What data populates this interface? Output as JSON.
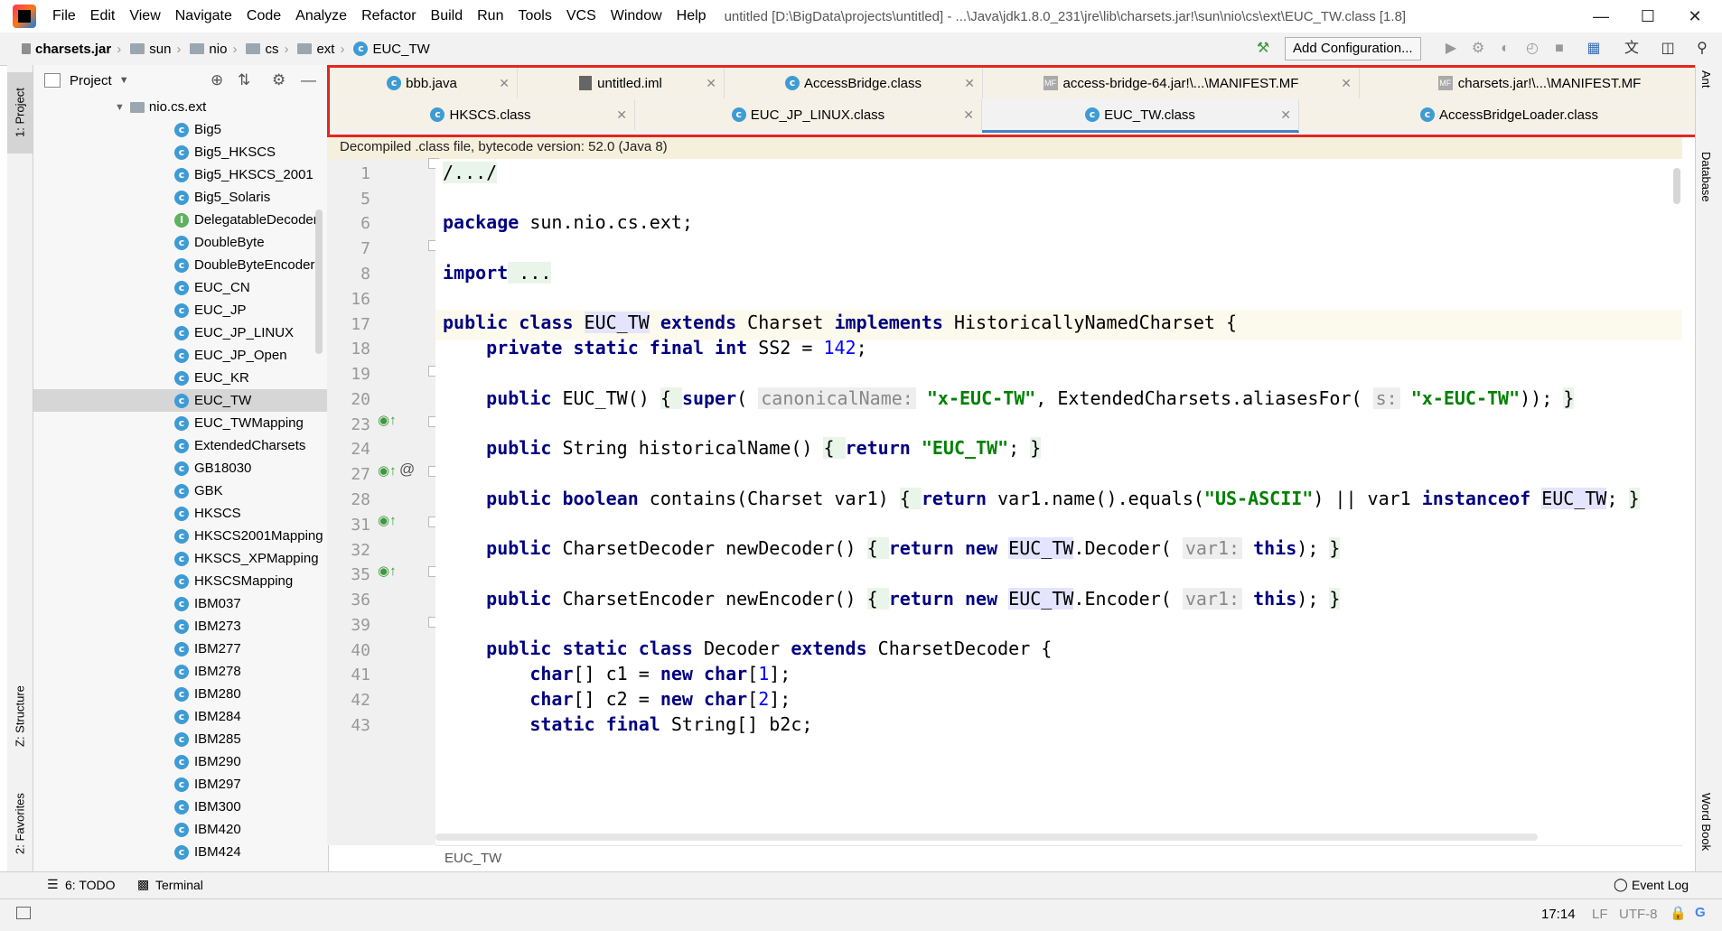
{
  "menubar": {
    "items": [
      "File",
      "Edit",
      "View",
      "Navigate",
      "Code",
      "Analyze",
      "Refactor",
      "Build",
      "Run",
      "Tools",
      "VCS",
      "Window",
      "Help"
    ],
    "window_title": "untitled [D:\\BigData\\projects\\untitled] - ...\\Java\\jdk1.8.0_231\\jre\\lib\\charsets.jar!\\sun\\nio\\cs\\ext\\EUC_TW.class [1.8]"
  },
  "navbar": {
    "crumbs": [
      "charsets.jar",
      "sun",
      "nio",
      "cs",
      "ext",
      "EUC_TW"
    ],
    "add_config": "Add Configuration..."
  },
  "left_strip": {
    "project": "1: Project",
    "structure": "Z: Structure",
    "favorites": "2: Favorites"
  },
  "project_panel": {
    "title": "Project",
    "root": "nio.cs.ext",
    "items": [
      "Big5",
      "Big5_HKSCS",
      "Big5_HKSCS_2001",
      "Big5_Solaris",
      "DelegatableDecoder",
      "DoubleByte",
      "DoubleByteEncoder",
      "EUC_CN",
      "EUC_JP",
      "EUC_JP_LINUX",
      "EUC_JP_Open",
      "EUC_KR",
      "EUC_TW",
      "EUC_TWMapping",
      "ExtendedCharsets",
      "GB18030",
      "GBK",
      "HKSCS",
      "HKSCS2001Mapping",
      "HKSCS_XPMapping",
      "HKSCSMapping",
      "IBM037",
      "IBM273",
      "IBM277",
      "IBM278",
      "IBM280",
      "IBM284",
      "IBM285",
      "IBM290",
      "IBM297",
      "IBM300",
      "IBM420",
      "IBM424"
    ],
    "selected": "EUC_TW"
  },
  "tabs": {
    "row1": [
      "bbb.java",
      "untitled.iml",
      "AccessBridge.class",
      "access-bridge-64.jar!\\...\\MANIFEST.MF",
      "charsets.jar!\\...\\MANIFEST.MF"
    ],
    "row2": [
      "HKSCS.class",
      "EUC_JP_LINUX.class",
      "EUC_TW.class",
      "AccessBridgeLoader.class"
    ],
    "active": "EUC_TW.class"
  },
  "editor": {
    "banner": "Decompiled .class file, bytecode version: 52.0 (Java 8)",
    "line_numbers": [
      "1",
      "5",
      "6",
      "7",
      "8",
      "16",
      "17",
      "18",
      "19",
      "20",
      "23",
      "24",
      "27",
      "28",
      "31",
      "32",
      "35",
      "36",
      "39",
      "40",
      "41",
      "42",
      "43"
    ],
    "breadcrumb": "EUC_TW",
    "c1": "/.../",
    "package_kw": "package",
    "package_name": " sun.nio.cs.ext;",
    "import_kw": "import",
    "import_rest": " ...",
    "hint_canonical": "canonicalName:",
    "hint_s": "s:",
    "hint_var1": "var1:",
    "str_xeuctw": "\"x-EUC-TW\"",
    "str_euctw": "\"EUC_TW\"",
    "str_usascii": "\"US-ASCII\"",
    "num_142": "142",
    "num_1": "1",
    "num_2": "2"
  },
  "right_strip": {
    "ant": "Ant",
    "database": "Database",
    "wordbook": "Word Book"
  },
  "bottom_tools": {
    "todo": "6: TODO",
    "terminal": "Terminal",
    "event_log": "Event Log"
  },
  "status": {
    "position": "17:14",
    "line_sep": "LF",
    "encoding": "UTF-8"
  }
}
